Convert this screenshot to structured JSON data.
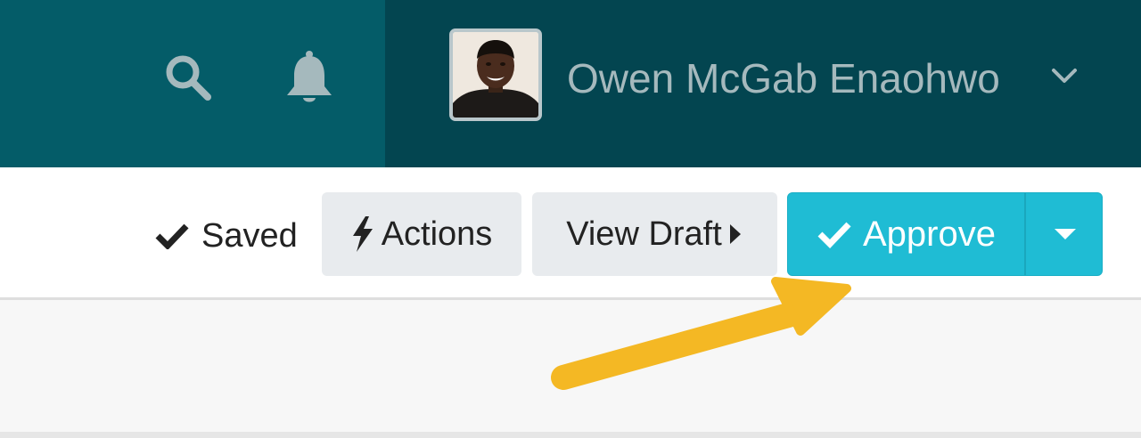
{
  "header": {
    "icons": [
      "search-icon",
      "bell-icon"
    ],
    "user": {
      "name": "Owen McGab Enaohwo",
      "menu_icon": "chevron-down-icon"
    },
    "colors": {
      "left": "#045c68",
      "right": "#034550",
      "icon": "#a5b9bd"
    }
  },
  "toolbar": {
    "saved_label": "Saved",
    "actions_label": "Actions",
    "view_draft_label": "View Draft",
    "approve_label": "Approve",
    "colors": {
      "approve": "#1fbcd4",
      "secondary": "#e8ebee"
    }
  },
  "annotation": {
    "icon": "arrow-pointer",
    "color": "#f4b824"
  }
}
